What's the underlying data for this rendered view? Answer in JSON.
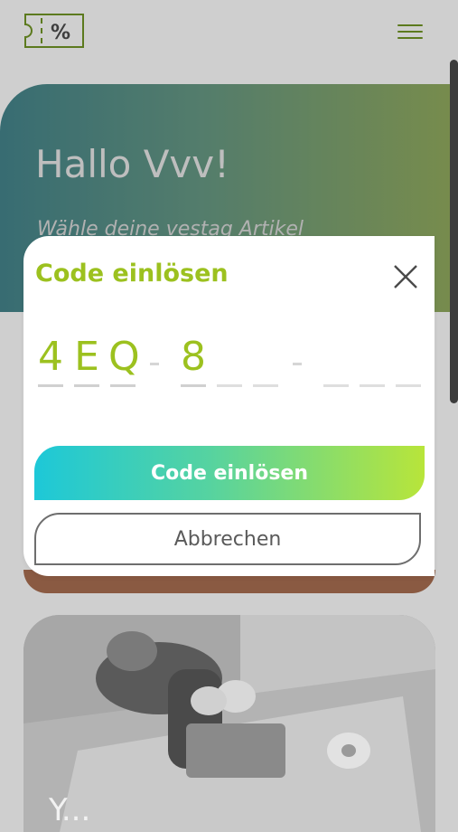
{
  "header": {
    "logo_icon": "coupon-percent-icon",
    "logo_text": "%",
    "menu_icon": "hamburger-menu-icon"
  },
  "hero": {
    "title": "Hallo Vvv!",
    "subtitle": "Wähle deine vestag Artikel"
  },
  "photo_card": {
    "caption": "Y..."
  },
  "dialog": {
    "title": "Code einlösen",
    "close_icon": "close-icon",
    "code_groups": [
      [
        "4",
        "E",
        "Q"
      ],
      [
        "8",
        "",
        ""
      ],
      [
        "",
        "",
        ""
      ]
    ],
    "separator": "-",
    "redeem_label": "Code einlösen",
    "cancel_label": "Abbrechen"
  },
  "colors": {
    "accent_green": "#9cc11f",
    "gradient_start": "#1dc8d8",
    "gradient_end": "#b8e53a",
    "overlay": "#cfcfcf"
  }
}
